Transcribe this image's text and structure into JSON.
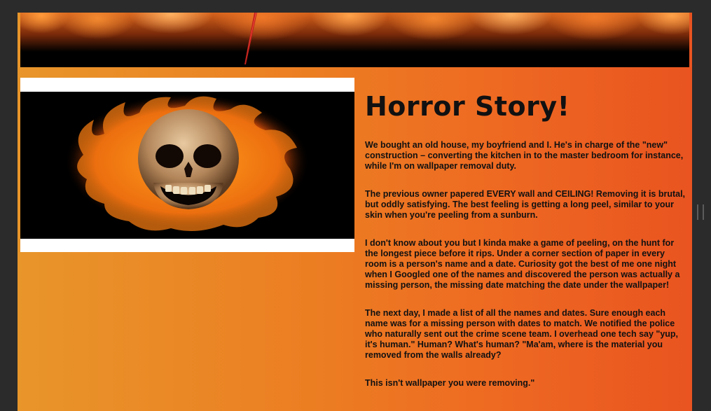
{
  "story": {
    "title": "Horror Story!",
    "paragraphs": [
      "We bought an old house, my boyfriend and I. He's in charge of the \"new\" construction – converting the kitchen in to the master bedroom for instance, while I'm on wallpaper removal duty.",
      "The previous owner papered EVERY wall and CEILING! Removing it is brutal, but oddly satisfying. The best feeling is getting a long peel, similar to your skin when you're peeling from a sunburn.",
      "I don't know about you but I kinda make a game of peeling, on the hunt for the longest piece before it rips. Under a corner section of paper in every room is a person's name and a date. Curiosity got the best of me one night when I Googled one of the names and discovered the person was actually a missing person, the missing date matching the date under the wallpaper!",
      "The next day, I made a list of all the names and dates. Sure enough each name was for a missing person with dates to match. We notified the police who naturally sent out the crime scene team. I overhead one tech say \"yup, it's human.\" Human? What's human? \"Ma'am, where is the material you removed from the walls already?",
      "This isn't wallpaper you were removing.\""
    ]
  },
  "colors": {
    "gradient_left": "#e8952a",
    "gradient_right": "#e95420",
    "banner_black": "#000000"
  }
}
